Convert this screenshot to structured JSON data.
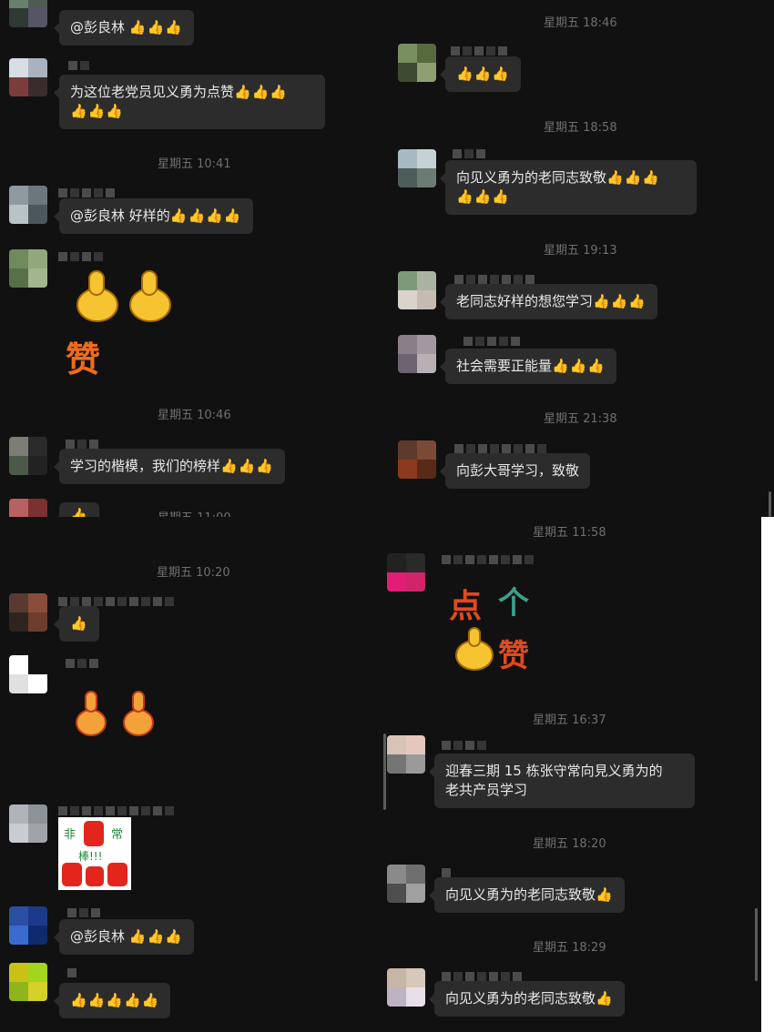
{
  "panel_a": {
    "messages": [
      {
        "text": "@彭良林 ",
        "thumbs": "👍👍👍"
      },
      {
        "text": "为这位老党员见义勇为点赞",
        "thumbs": "👍👍👍",
        "thumbs2": "👍👍👍"
      },
      {
        "time": "星期五 10:41"
      },
      {
        "text": "@彭良林 好样的",
        "thumbs": "👍👍👍👍"
      },
      {
        "sticker_text": "赞"
      },
      {
        "time": "星期五 10:46"
      },
      {
        "text": "学习的楷模，我们的榜样",
        "thumbs": "👍👍👍"
      },
      {
        "thumbs": "👍"
      },
      {
        "time_partial": "星期五 11:00"
      }
    ]
  },
  "panel_b": {
    "messages": [
      {
        "time": "星期五 18:46"
      },
      {
        "thumbs": "👍👍👍"
      },
      {
        "time": "星期五 18:58"
      },
      {
        "text": "向见义勇为的老同志致敬",
        "thumbs": "👍👍👍",
        "thumbs2": "👍👍👍"
      },
      {
        "time": "星期五 19:13"
      },
      {
        "text": "老同志好样的想您学习",
        "thumbs": "👍👍👍"
      },
      {
        "text": "社会需要正能量",
        "thumbs": "👍👍👍"
      },
      {
        "time": "星期五 21:38"
      },
      {
        "text": "向彭大哥学习，致敬"
      }
    ]
  },
  "panel_c": {
    "messages": [
      {
        "time": "星期五 10:20"
      },
      {
        "thumbs": "👍"
      },
      {
        "sticker": "thumbs"
      },
      {
        "sticker_text": "非常棒!!!",
        "sticker_chars": [
          "非",
          "常",
          "棒!!!"
        ]
      },
      {
        "text": "@彭良林 ",
        "thumbs": "👍👍👍"
      },
      {
        "thumbs": "👍👍👍👍👍"
      }
    ]
  },
  "panel_d": {
    "messages": [
      {
        "time": "星期五 11:58"
      },
      {
        "sticker_text": [
          "点",
          "个",
          "赞"
        ]
      },
      {
        "time": "星期五 16:37"
      },
      {
        "text_line1": "迎春三期 15 栋张守常向見义勇为的",
        "text_line2": "老共产员学习"
      },
      {
        "time": "星期五 18:20"
      },
      {
        "text": "向见义勇为的老同志致敬",
        "thumbs": "👍"
      },
      {
        "time": "星期五 18:29"
      },
      {
        "text": "向见义勇为的老同志致敬",
        "thumbs": "👍"
      }
    ]
  },
  "colors": {
    "background": "#111111",
    "bubble": "#2c2c2c",
    "timestamp": "#6f6f6f",
    "thumbs": "#f2b824"
  }
}
